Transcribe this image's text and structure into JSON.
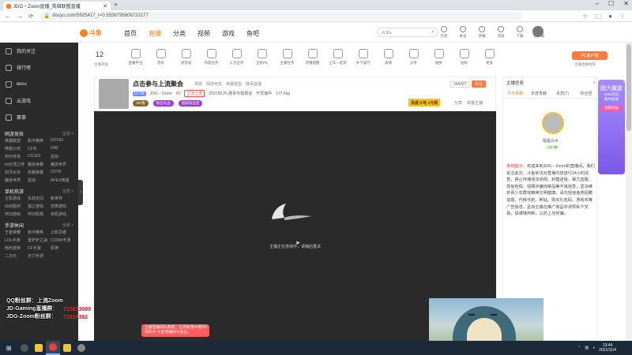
{
  "browser": {
    "tab_title": "JDG・Zoom直播_英雄联盟直播",
    "url": "douyu.com/5925417_r=0.5556795806722177",
    "nav_back": "←",
    "nav_fwd": "→",
    "nav_reload": "⟳",
    "win_min": "–",
    "win_max": "☐",
    "win_close": "✕"
  },
  "sidebar": {
    "items": [
      {
        "label": "我的关注"
      },
      {
        "label": "排行榜"
      },
      {
        "label": "виsu"
      },
      {
        "label": "云游戏"
      },
      {
        "label": "赛事"
      }
    ],
    "sections": [
      {
        "title": "网游竞技",
        "all": "全部 >",
        "links": [
          "英雄联盟",
          "和平精英",
          "DOTA2",
          "穿越火线",
          "CF手",
          "DNF",
          "炉石传说",
          "CS:GO",
          "逆战",
          "lol云顶之弈",
          "魔兽争霸",
          "魔兽世界",
          "剑灵水浒",
          "风暴英雄",
          "DOTA",
          "魔兽世界",
          "逆战",
          "APEX英雄"
        ]
      },
      {
        "title": "单机热游",
        "all": "全部 >",
        "links": [
          "主机游戏",
          "永劫无间",
          "新世界",
          "仙剑题材",
          "独立游戏",
          "恐怖游戏",
          "怀旧游戏",
          "怀旧经典",
          "单机游戏"
        ]
      },
      {
        "title": "手游休闲",
        "all": "全部 >",
        "links": [
          "王者荣耀",
          "和平精英",
          "火影忍者",
          "LOL手游",
          "金铲铲之战",
          "CODM手游",
          "哈利波特",
          "CF手游",
          "原神",
          "二次元",
          "天刀手游"
        ]
      }
    ]
  },
  "site": {
    "logo": "斗鱼",
    "nav": [
      "首页",
      "直播",
      "分类",
      "视频",
      "游戏",
      "鱼吧"
    ],
    "search_placeholder": "大家a",
    "top_icons": [
      {
        "label": "历史"
      },
      {
        "label": "关注"
      },
      {
        "label": "开播"
      },
      {
        "label": "消息"
      },
      {
        "label": "下载"
      },
      {
        "label": "客户端"
      }
    ]
  },
  "room_strip": {
    "level_num": "12",
    "level_label": "主播等级",
    "icons": [
      "直播平台",
      "音乐",
      "语音动",
      "热度任务",
      "火力全开",
      "全民PK",
      "主播任务",
      "开播提醒",
      "上车一起玩",
      "乡下骑行",
      "表情",
      "分享",
      "抽奖",
      "钻粉",
      "更多"
    ],
    "pc_button": "PC客户端",
    "pc_label": "主播直播推荐"
  },
  "room": {
    "title": "点击参与上流聚会",
    "report": "举报",
    "tags": [
      "网游竞技",
      "英雄联盟",
      "赛事直播"
    ],
    "level": "LV 55",
    "name": "JDG・Zoom",
    "hot": "29",
    "location": "上流上游",
    "location_note": "2021年LPL赛事专题报道",
    "followers_label": "开发播中",
    "weight": "127.6kg",
    "badges": [
      "VIP客",
      "粉丝礼品",
      "超级粉丝团"
    ],
    "follow_count": "344427",
    "follow_label": "关注",
    "promo": "百度斗地 1元领",
    "share": "分享",
    "tipoff": "举报主播"
  },
  "player": {
    "message": "主播正在连线中，请稍后重试"
  },
  "right_panel": {
    "header": "主播任务",
    "tabs": [
      "今日贡献",
      "年度贡献",
      "贵宾(7)",
      "粉丝团"
    ],
    "rank_name": "醒醒白木",
    "rank_level": "LV 38",
    "sys_label": "系统提示：",
    "sys_text": "欢迎来到JDG・Zoom的直播间，我们关注此次，斗鱼依法对直播内容进行24小时巡查，禁止传播违法违规、封建迷信、暴力血腥、低俗色情、招嫖诈骗违禁品等不良信息，坚决维护青少年群体精神文明健康。请勿轻信各类招聘征婚、代练代抢、刷钻、购买礼包码、游戏币等广告信息，且如主播在推广商品中诱导私下交易，请谨慎判断，以防上当受骗。"
  },
  "ad": {
    "title": "超大魔盒",
    "line1": "2025开启",
    "line2": "集中加速",
    "btn": "领取奖励"
  },
  "overlay": {
    "text_lines": [
      "QQ粉丝群：上流Zoom",
      "JD-Gaming直播群：",
      "JDG-Zoom粉丝群："
    ],
    "qq_lines": [
      "715833099",
      "71819382"
    ]
  },
  "toast": {
    "text": "主播直播间头像距，任务处理中用户资料中 斗鱼直播间斗鱼主。",
    "close": "✕"
  },
  "taskbar": {
    "start": "⊞",
    "time": "13:44",
    "date": "2021/11/4"
  },
  "colors": {
    "accent": "#f58220",
    "dark": "#2b2b2b"
  }
}
